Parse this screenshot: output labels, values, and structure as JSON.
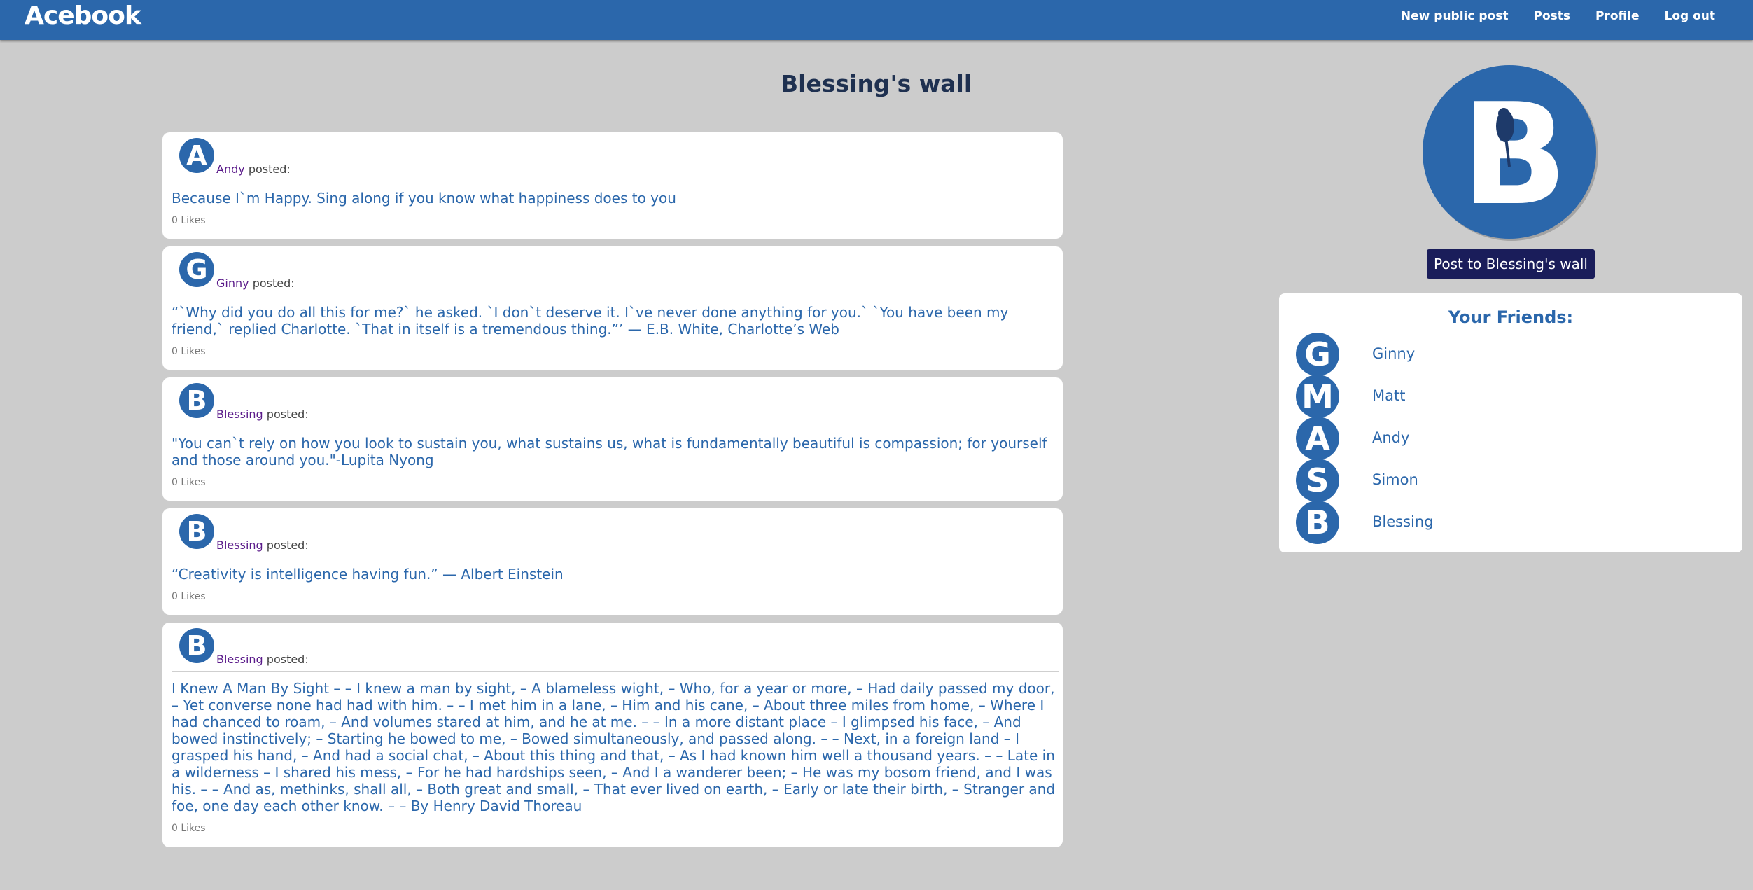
{
  "nav": {
    "logo_text": "Acebook",
    "links": [
      "New public post",
      "Posts",
      "Profile",
      "Log out"
    ]
  },
  "wall": {
    "title": "Blessing's wall"
  },
  "posted_suffix": "posted:",
  "posts": [
    {
      "author": "Andy",
      "avatar_letter": "A",
      "body": "Because I`m Happy. Sing along if you know what happiness does to you",
      "likes": "0 Likes"
    },
    {
      "author": "Ginny",
      "avatar_letter": "G",
      "body": "“`Why did you do all this for me?` he asked. `I don`t deserve it. I`ve never done anything for you.` `You have been my friend,` replied Charlotte. `That in itself is a tremendous thing.”’ — E.B. White, Charlotte’s Web",
      "likes": "0 Likes"
    },
    {
      "author": "Blessing",
      "avatar_letter": "B",
      "body": "\"You can`t rely on how you look to sustain you, what sustains us, what is fundamentally beautiful is compassion; for yourself and those around you.\"-Lupita Nyong",
      "likes": "0 Likes"
    },
    {
      "author": "Blessing",
      "avatar_letter": "B",
      "body": "“Creativity is intelligence having fun.” — Albert Einstein",
      "likes": "0 Likes"
    },
    {
      "author": "Blessing",
      "avatar_letter": "B",
      "body": "I Knew A Man By Sight – – I knew a man by sight, – A blameless wight, – Who, for a year or more, – Had daily passed my door, – Yet converse none had had with him. – – I met him in a lane, – Him and his cane, – About three miles from home, – Where I had chanced to roam, – And volumes stared at him, and he at me. – – In a more distant place – I glimpsed his face, – And bowed instinctively; – Starting he bowed to me, – Bowed simultaneously, and passed along. – – Next, in a foreign land – I grasped his hand, – And had a social chat, – About this thing and that, – As I had known him well a thousand years. – – Late in a wilderness – I shared his mess, – For he had hardships seen, – And I a wanderer been; – He was my bosom friend, and I was his. – – And as, methinks, shall all, – Both great and small, – That ever lived on earth, – Early or late their birth, – Stranger and foe, one day each other know. – – By Henry David Thoreau",
      "likes": "0 Likes"
    }
  ],
  "profile": {
    "avatar_letter": "B",
    "post_button_label": "Post to Blessing's wall"
  },
  "friends": {
    "title": "Your Friends:",
    "items": [
      {
        "name": "Ginny",
        "avatar_letter": "G"
      },
      {
        "name": "Matt",
        "avatar_letter": "M"
      },
      {
        "name": "Andy",
        "avatar_letter": "A"
      },
      {
        "name": "Simon",
        "avatar_letter": "S"
      },
      {
        "name": "Blessing",
        "avatar_letter": "B"
      }
    ]
  },
  "colors": {
    "brand_blue": "#2b67ab",
    "background": "#cccccc",
    "button_dark": "#1a1d5a",
    "author_purple": "#5a1a8a"
  }
}
